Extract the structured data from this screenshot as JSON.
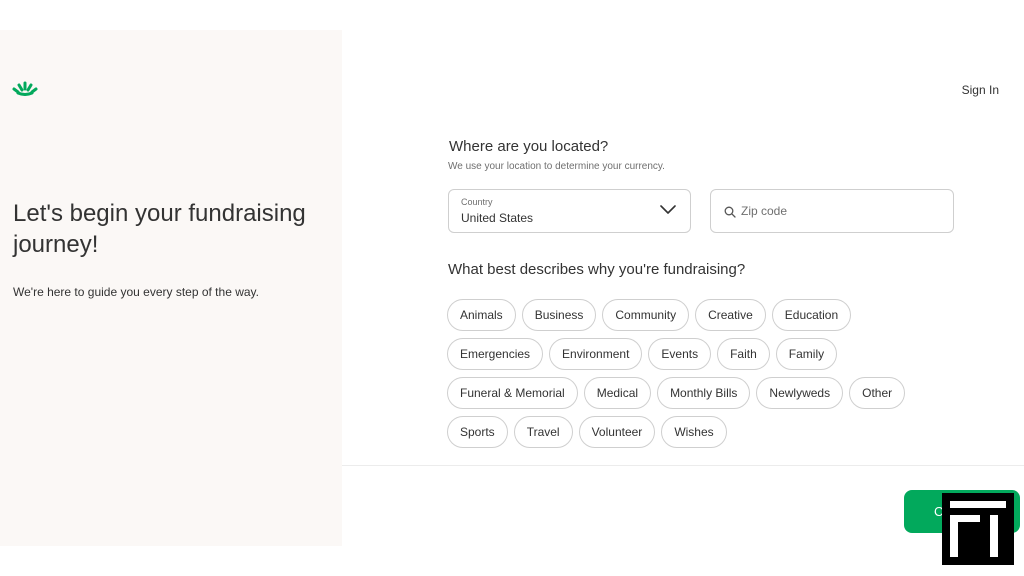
{
  "brand": {
    "logo_icon": "sprout-logo-icon",
    "accent": "#02a95c"
  },
  "intro": {
    "headline": "Let's begin your fundraising journey!",
    "subline": "We're here to guide you every step of the way."
  },
  "header": {
    "sign_in": "Sign In"
  },
  "location": {
    "question": "Where are you located?",
    "helper": "We use your location to determine your currency.",
    "country_label": "Country",
    "country_value": "United States",
    "zip_placeholder": "Zip code"
  },
  "reason": {
    "question": "What best describes why you're fundraising?",
    "rows": [
      [
        "Animals",
        "Business",
        "Community",
        "Creative",
        "Education"
      ],
      [
        "Emergencies",
        "Environment",
        "Events",
        "Faith",
        "Family"
      ],
      [
        "Funeral & Memorial",
        "Medical",
        "Monthly Bills",
        "Newlyweds",
        "Other"
      ],
      [
        "Sports",
        "Travel",
        "Volunteer",
        "Wishes"
      ]
    ]
  },
  "footer": {
    "continue_label": "C"
  }
}
